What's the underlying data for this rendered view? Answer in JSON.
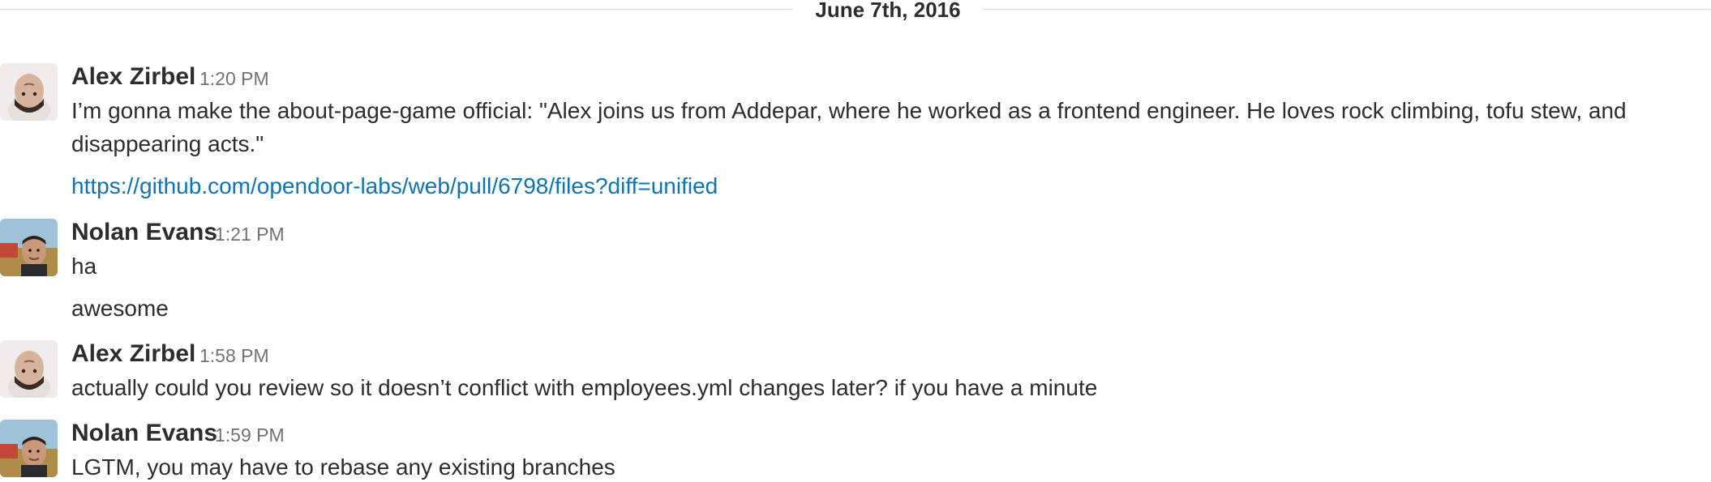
{
  "date_divider": "June 7th, 2016",
  "colors": {
    "link": "#0b75b8",
    "text": "#2c2d30",
    "timestamp": "#717274",
    "divider": "#dcdcdc"
  },
  "messages": [
    {
      "author": "Alex Zirbel",
      "time": "1:20 PM",
      "avatar": "avatar-alex-zirbel",
      "lines": [
        "I’m gonna make the about-page-game official: \"Alex joins us from Addepar, where he worked as a frontend engineer. He loves rock climbing, tofu stew, and",
        "disappearing acts.\""
      ],
      "link": "https://github.com/opendoor-labs/web/pull/6798/files?diff=unified"
    },
    {
      "author": "Nolan Evans",
      "time": "1:21 PM",
      "avatar": "avatar-nolan-evans",
      "lines": [
        "ha",
        "awesome"
      ]
    },
    {
      "author": "Alex Zirbel",
      "time": "1:58 PM",
      "avatar": "avatar-alex-zirbel",
      "lines": [
        "actually could you review so it doesn’t conflict with employees.yml changes later? if you have a minute"
      ]
    },
    {
      "author": "Nolan Evans",
      "time": "1:59 PM",
      "avatar": "avatar-nolan-evans",
      "lines": [
        "LGTM, you may have to rebase any existing branches"
      ]
    }
  ]
}
